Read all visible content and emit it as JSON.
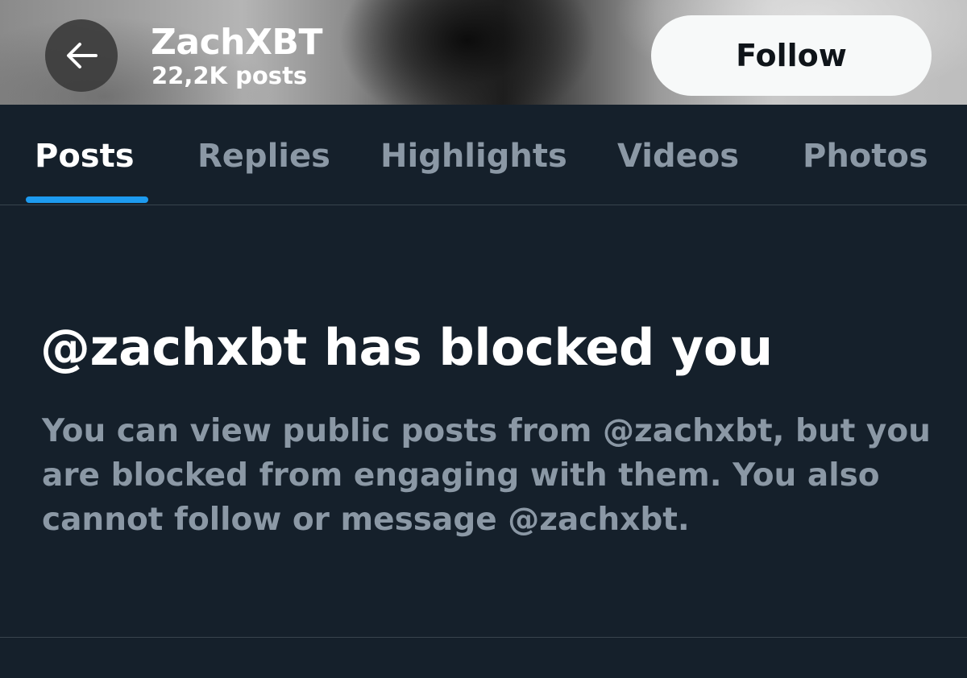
{
  "header": {
    "profile_name": "ZachXBT",
    "post_count": "22,2K posts",
    "follow_label": "Follow",
    "back_icon": "arrow-left-icon"
  },
  "tabs": [
    {
      "label": "Posts",
      "active": true
    },
    {
      "label": "Replies",
      "active": false
    },
    {
      "label": "Highlights",
      "active": false
    },
    {
      "label": "Videos",
      "active": false
    },
    {
      "label": "Photos",
      "active": false
    }
  ],
  "blocked": {
    "title": "@zachxbt has blocked you",
    "description": "You can view public posts from @zachxbt, but you are blocked from engaging with them. You also cannot follow or message @zachxbt."
  },
  "colors": {
    "background": "#15202b",
    "accent": "#1d9bf0",
    "text_primary": "#ffffff",
    "text_secondary": "#8b98a5",
    "divider": "#38444d"
  }
}
